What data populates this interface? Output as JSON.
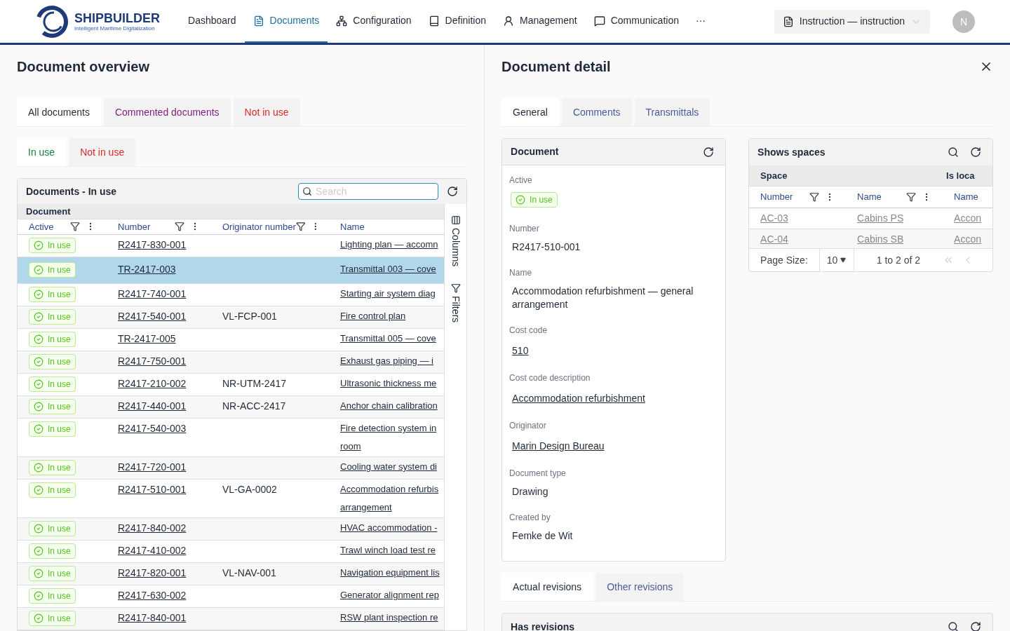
{
  "brand": {
    "name": "SHIPBUILDER",
    "tagline": "Intelligent Maritime Digitalization"
  },
  "nav": [
    {
      "label": "Dashboard",
      "selected": false
    },
    {
      "label": "Documents",
      "selected": true
    },
    {
      "label": "Configuration",
      "selected": false
    },
    {
      "label": "Definition",
      "selected": false
    },
    {
      "label": "Management",
      "selected": false
    },
    {
      "label": "Communication",
      "selected": false
    },
    {
      "label": "···",
      "selected": false
    }
  ],
  "context_selector": "Instruction — instruction",
  "avatar": "N",
  "overview": {
    "title": "Document overview",
    "tabs": [
      {
        "label": "All documents",
        "selected": true,
        "color": "#1f2937"
      },
      {
        "label": "Commented documents",
        "selected": false,
        "color": "#7e1a7e"
      },
      {
        "label": "Not in use",
        "selected": false,
        "color": "#dc2626"
      }
    ],
    "subtabs": [
      {
        "label": "In use",
        "selected": true,
        "color": "#15803d"
      },
      {
        "label": "Not in use",
        "selected": false,
        "color": "#dc2626"
      }
    ],
    "grid": {
      "title": "Documents - In use",
      "search_placeholder": "Search",
      "group": "Document",
      "columns": [
        "Active",
        "Number",
        "Originator number",
        "Name"
      ],
      "side_buttons": [
        "Columns",
        "Filters"
      ],
      "rows": [
        {
          "active": "In use",
          "number": "R2417-830-001",
          "originator": "",
          "name": "Lighting plan — accomn",
          "selected": false
        },
        {
          "active": "In use",
          "number": "TR-2417-003",
          "originator": "",
          "name": "Transmittal 003 — cove",
          "selected": true
        },
        {
          "active": "In use",
          "number": "R2417-740-001",
          "originator": "",
          "name": "Starting air system diag",
          "selected": false
        },
        {
          "active": "In use",
          "number": "R2417-540-001",
          "originator": "VL-FCP-001",
          "name": "Fire control plan",
          "selected": false
        },
        {
          "active": "In use",
          "number": "TR-2417-005",
          "originator": "",
          "name": "Transmittal 005 — cove",
          "selected": false
        },
        {
          "active": "In use",
          "number": "R2417-750-001",
          "originator": "",
          "name": "Exhaust gas piping — i",
          "selected": false
        },
        {
          "active": "In use",
          "number": "R2417-210-002",
          "originator": "NR-UTM-2417",
          "name": "Ultrasonic thickness me",
          "selected": false
        },
        {
          "active": "In use",
          "number": "R2417-440-001",
          "originator": "NR-ACC-2417",
          "name": "Anchor chain calibration",
          "selected": false
        },
        {
          "active": "In use",
          "number": "R2417-540-003",
          "originator": "",
          "name": [
            "Fire detection system in",
            "room"
          ],
          "selected": false
        },
        {
          "active": "In use",
          "number": "R2417-720-001",
          "originator": "",
          "name": "Cooling water system di",
          "selected": false
        },
        {
          "active": "In use",
          "number": "R2417-510-001",
          "originator": "VL-GA-0002",
          "name": [
            "Accommodation refurbis",
            "arrangement"
          ],
          "selected": false
        },
        {
          "active": "In use",
          "number": "R2417-840-002",
          "originator": "",
          "name": "HVAC accommodation -",
          "selected": false
        },
        {
          "active": "In use",
          "number": "R2417-410-002",
          "originator": "",
          "name": "Trawl winch load test re",
          "selected": false
        },
        {
          "active": "In use",
          "number": "R2417-820-001",
          "originator": "VL-NAV-001",
          "name": "Navigation equipment lis",
          "selected": false
        },
        {
          "active": "In use",
          "number": "R2417-630-002",
          "originator": "",
          "name": "Generator alignment rep",
          "selected": false
        },
        {
          "active": "In use",
          "number": "R2417-840-001",
          "originator": "",
          "name": "RSW plant inspection re",
          "selected": false
        }
      ]
    }
  },
  "detail": {
    "title": "Document detail",
    "tabs": [
      {
        "label": "General",
        "selected": true
      },
      {
        "label": "Comments",
        "selected": false
      },
      {
        "label": "Transmittals",
        "selected": false
      }
    ],
    "card": {
      "title": "Document",
      "fields": [
        {
          "label": "Active",
          "value": "In use",
          "kind": "badge"
        },
        {
          "label": "Number",
          "value": "R2417-510-001",
          "kind": "text"
        },
        {
          "label": "Name",
          "value": "Accommodation refurbishment — general arrangement",
          "kind": "text"
        },
        {
          "label": "Cost code",
          "value": "510",
          "kind": "link"
        },
        {
          "label": "Cost code description",
          "value": "Accommodation refurbishment",
          "kind": "link"
        },
        {
          "label": "Originator",
          "value": "Marin Design Bureau",
          "kind": "link"
        },
        {
          "label": "Document type",
          "value": "Drawing",
          "kind": "text"
        },
        {
          "label": "Created by",
          "value": "Femke de Wit",
          "kind": "text"
        }
      ]
    },
    "spaces": {
      "title": "Shows spaces",
      "groups": [
        "Space",
        "Is loca"
      ],
      "columns": [
        "Number",
        "Name",
        "Name"
      ],
      "rows": [
        [
          "AC-03",
          "Cabins PS",
          "Accon"
        ],
        [
          "AC-04",
          "Cabins SB",
          "Accon"
        ]
      ],
      "page_size_label": "Page Size:",
      "page_size": "10",
      "range": "1 to 2 of 2"
    },
    "revision_tabs": [
      {
        "label": "Actual revisions",
        "selected": true
      },
      {
        "label": "Other revisions",
        "selected": false
      }
    ],
    "revisions": {
      "title": "Has revisions"
    }
  }
}
